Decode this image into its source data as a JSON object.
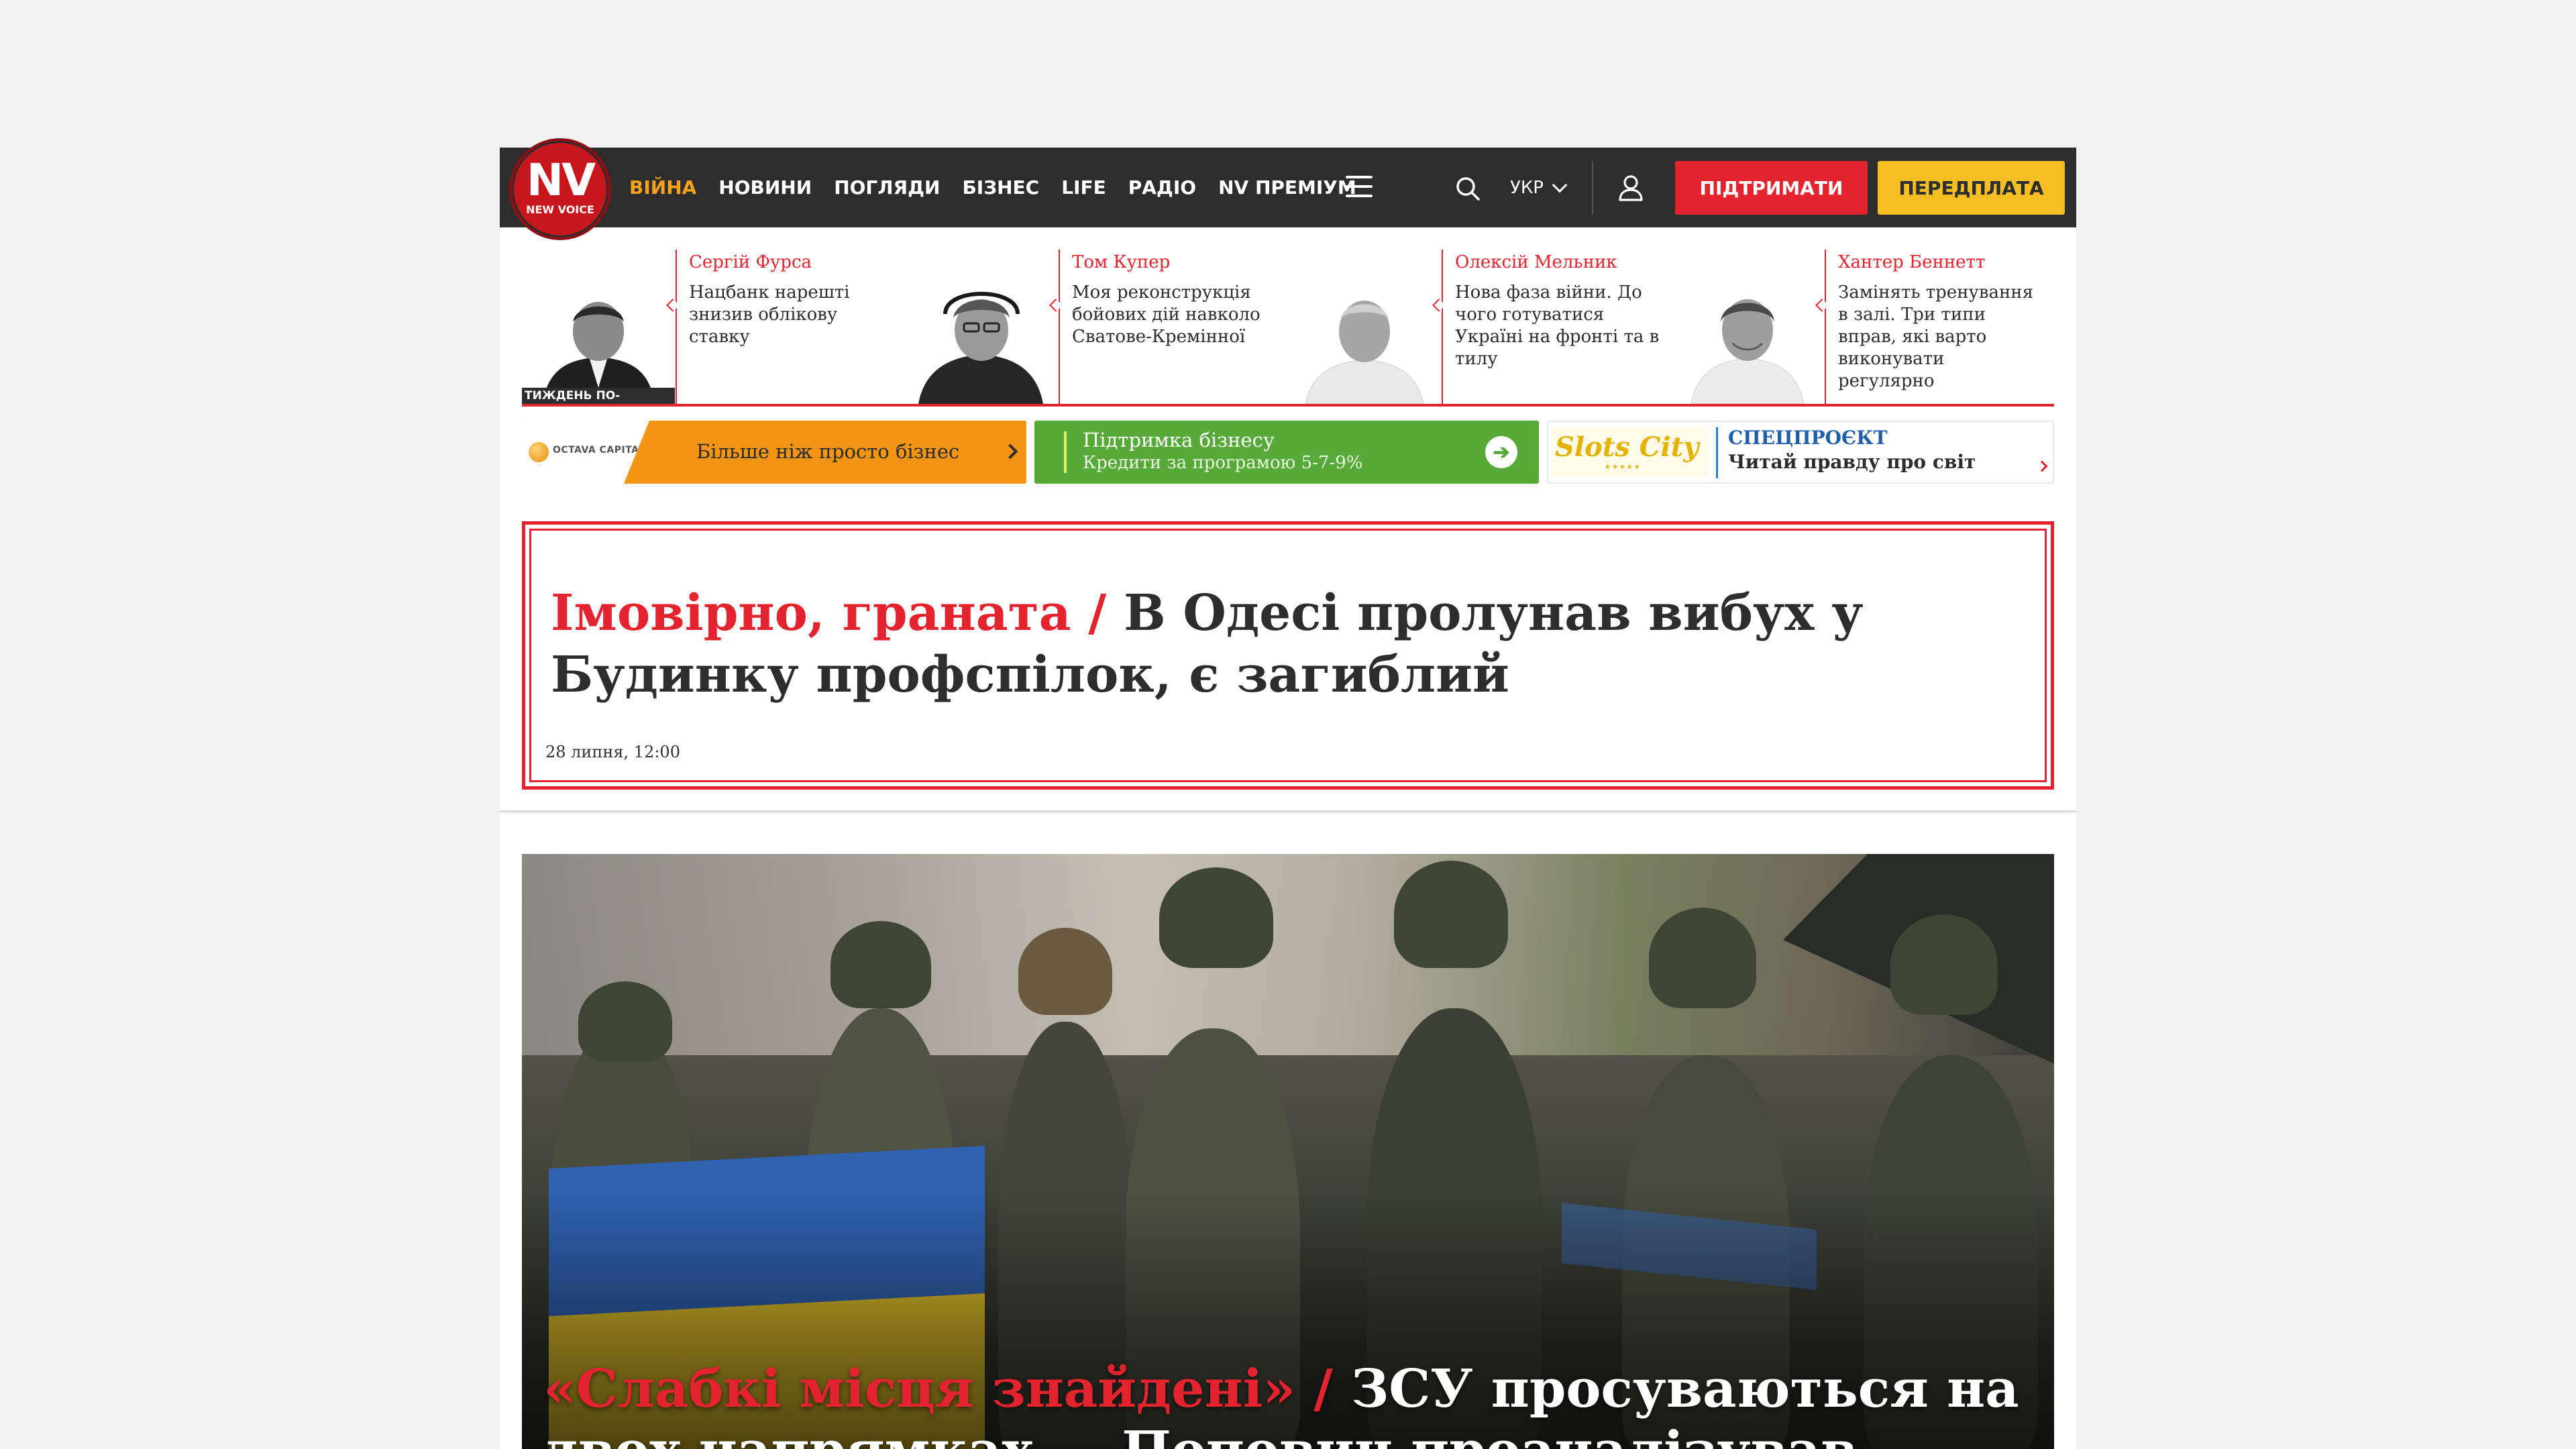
{
  "header": {
    "logo_text": "NV",
    "logo_subtext": "NEW VOICE",
    "nav": [
      "ВІЙНА",
      "НОВИНИ",
      "ПОГЛЯДИ",
      "БІЗНЕС",
      "LIFE",
      "РАДІО",
      "NV ПРЕМІУМ"
    ],
    "language": "УКР",
    "support_label": "ПІДТРИМАТИ",
    "subscribe_label": "ПЕРЕДПЛАТА",
    "colors": {
      "bar": "#2d2d2d",
      "active": "#f6a21c",
      "support": "#e3232e",
      "subscribe": "#f5bf23"
    }
  },
  "columnists": [
    {
      "author": "Сергій Фурса",
      "headline": "Нацбанк нарешті знизив облікову ставку",
      "badge": "ТИЖДЕНЬ ПО-ДІЛОВОМУ"
    },
    {
      "author": "Том Купер",
      "headline": "Моя реконструкція бойових дій навколо Сватове-Кремінної"
    },
    {
      "author": "Олексій Мельник",
      "headline": "Нова фаза війни. До чого готуватися Україні на фронті та в тилу"
    },
    {
      "author": "Хантер Беннетт",
      "headline": "Замінять тренування в залі. Три типи вправ, які варто виконувати регулярно"
    }
  ],
  "banners": {
    "octava": {
      "brand": "OCTAVA CAPITAL",
      "slogan": "Більше ніж просто бізнес"
    },
    "business": {
      "line1": "Підтримка бізнесу",
      "line2": "Кредити за програмою 5-7-9%"
    },
    "special": {
      "brand": "Slots City",
      "label": "СПЕЦПРОЄКТ",
      "text": "Читай правду про світ азарту"
    }
  },
  "breaking": {
    "kicker": "Імовірно, граната /",
    "title": "В Одесі пролунав вибух у Будинку профспілок, є загиблий",
    "date": "28 липня, 12:00"
  },
  "hero": {
    "kicker": "«Слабкі місця знайдені» /",
    "title": "ЗСУ просуваються на двох напрямках — Попович проаналізував"
  }
}
